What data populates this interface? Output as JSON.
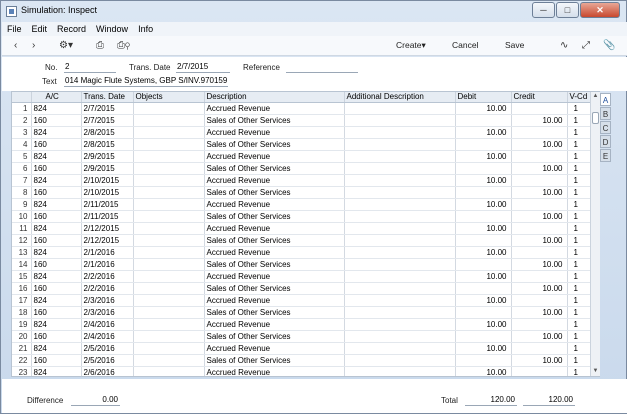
{
  "window": {
    "title": "Simulation: Inspect"
  },
  "menu": [
    "File",
    "Edit",
    "Record",
    "Window",
    "Info"
  ],
  "toolbar": {
    "create": "Create",
    "cancel": "Cancel",
    "save": "Save"
  },
  "form": {
    "no_label": "No.",
    "no_value": "2",
    "date_label": "Trans. Date",
    "date_value": "2/7/2015",
    "ref_label": "Reference",
    "ref_value": "",
    "text_label": "Text",
    "text_value": "014 Magic Flute Systems, GBP  S/INV.970159"
  },
  "columns": [
    "",
    "A/C",
    "Trans. Date",
    "Objects",
    "Description",
    "Additional Description",
    "Debit",
    "Credit",
    "V-Cd"
  ],
  "rows": [
    [
      "1",
      "824",
      "2/7/2015",
      "",
      "Accrued Revenue",
      "",
      "10.00",
      "",
      "1"
    ],
    [
      "2",
      "160",
      "2/7/2015",
      "",
      "Sales of Other Services",
      "",
      "",
      "10.00",
      "1"
    ],
    [
      "3",
      "824",
      "2/8/2015",
      "",
      "Accrued Revenue",
      "",
      "10.00",
      "",
      "1"
    ],
    [
      "4",
      "160",
      "2/8/2015",
      "",
      "Sales of Other Services",
      "",
      "",
      "10.00",
      "1"
    ],
    [
      "5",
      "824",
      "2/9/2015",
      "",
      "Accrued Revenue",
      "",
      "10.00",
      "",
      "1"
    ],
    [
      "6",
      "160",
      "2/9/2015",
      "",
      "Sales of Other Services",
      "",
      "",
      "10.00",
      "1"
    ],
    [
      "7",
      "824",
      "2/10/2015",
      "",
      "Accrued Revenue",
      "",
      "10.00",
      "",
      "1"
    ],
    [
      "8",
      "160",
      "2/10/2015",
      "",
      "Sales of Other Services",
      "",
      "",
      "10.00",
      "1"
    ],
    [
      "9",
      "824",
      "2/11/2015",
      "",
      "Accrued Revenue",
      "",
      "10.00",
      "",
      "1"
    ],
    [
      "10",
      "160",
      "2/11/2015",
      "",
      "Sales of Other Services",
      "",
      "",
      "10.00",
      "1"
    ],
    [
      "11",
      "824",
      "2/12/2015",
      "",
      "Accrued Revenue",
      "",
      "10.00",
      "",
      "1"
    ],
    [
      "12",
      "160",
      "2/12/2015",
      "",
      "Sales of Other Services",
      "",
      "",
      "10.00",
      "1"
    ],
    [
      "13",
      "824",
      "2/1/2016",
      "",
      "Accrued Revenue",
      "",
      "10.00",
      "",
      "1"
    ],
    [
      "14",
      "160",
      "2/1/2016",
      "",
      "Sales of Other Services",
      "",
      "",
      "10.00",
      "1"
    ],
    [
      "15",
      "824",
      "2/2/2016",
      "",
      "Accrued Revenue",
      "",
      "10.00",
      "",
      "1"
    ],
    [
      "16",
      "160",
      "2/2/2016",
      "",
      "Sales of Other Services",
      "",
      "",
      "10.00",
      "1"
    ],
    [
      "17",
      "824",
      "2/3/2016",
      "",
      "Accrued Revenue",
      "",
      "10.00",
      "",
      "1"
    ],
    [
      "18",
      "160",
      "2/3/2016",
      "",
      "Sales of Other Services",
      "",
      "",
      "10.00",
      "1"
    ],
    [
      "19",
      "824",
      "2/4/2016",
      "",
      "Accrued Revenue",
      "",
      "10.00",
      "",
      "1"
    ],
    [
      "20",
      "160",
      "2/4/2016",
      "",
      "Sales of Other Services",
      "",
      "",
      "10.00",
      "1"
    ],
    [
      "21",
      "824",
      "2/5/2016",
      "",
      "Accrued Revenue",
      "",
      "10.00",
      "",
      "1"
    ],
    [
      "22",
      "160",
      "2/5/2016",
      "",
      "Sales of Other Services",
      "",
      "",
      "10.00",
      "1"
    ],
    [
      "23",
      "824",
      "2/6/2016",
      "",
      "Accrued Revenue",
      "",
      "10.00",
      "",
      "1"
    ]
  ],
  "tabs": [
    "A",
    "B",
    "C",
    "D",
    "E"
  ],
  "footer": {
    "difference_label": "Difference",
    "difference_value": "0.00",
    "total_label": "Total",
    "total_debit": "120.00",
    "total_credit": "120.00"
  }
}
